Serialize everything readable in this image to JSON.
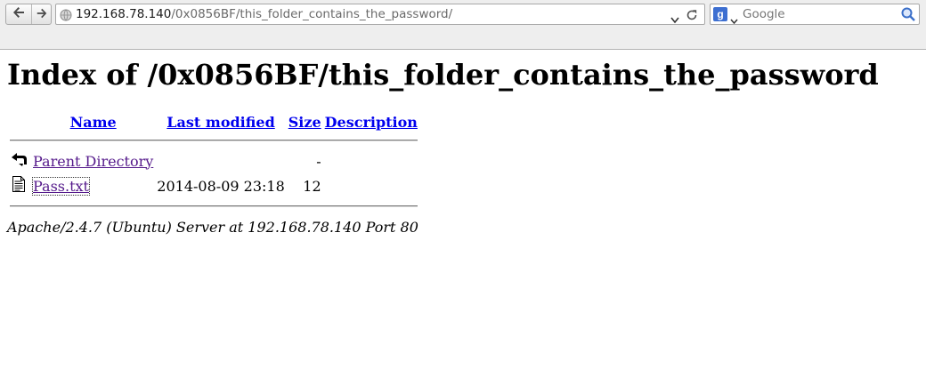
{
  "browser": {
    "url_host": "192.168.78.140",
    "url_path": "/0x0856BF/this_folder_contains_the_password/",
    "search_placeholder": "Google",
    "search_engine_letter": "g",
    "icons": [
      "back-arrow-icon",
      "forward-arrow-icon",
      "globe-icon",
      "dropdown-arrow-icon",
      "reload-icon",
      "google-icon",
      "magnifier-icon"
    ]
  },
  "page": {
    "title": "Index of /0x0856BF/this_folder_contains_the_password",
    "columns": {
      "name": "Name",
      "last_modified": "Last modified",
      "size": "Size",
      "description": "Description"
    },
    "rows": [
      {
        "icon": "back-arrow-icon",
        "name": "Parent Directory",
        "last_modified": "",
        "size": "-",
        "description": ""
      },
      {
        "icon": "text-file-icon",
        "name": "Pass.txt",
        "last_modified": "2014-08-09 23:18",
        "size": "12",
        "description": ""
      }
    ],
    "footer": "Apache/2.4.7 (Ubuntu) Server at 192.168.78.140 Port 80"
  }
}
